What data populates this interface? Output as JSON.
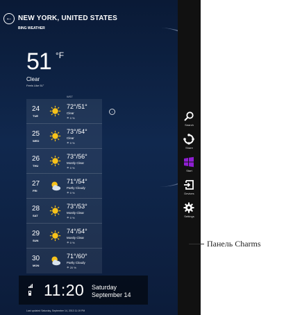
{
  "header": {
    "city": "NEW YORK, UNITED STATES",
    "app_name": "BING WEATHER"
  },
  "current": {
    "temperature": "51",
    "unit": "°F",
    "condition": "Clear",
    "feels_like": "Feels Like 51°",
    "wind_header": "WST"
  },
  "forecast": [
    {
      "date": "24",
      "day": "TUE",
      "hilo": "72°/51°",
      "condition": "Clear",
      "precip": "☂ 0 %",
      "icon": "sun-icon"
    },
    {
      "date": "25",
      "day": "WED",
      "hilo": "73°/54°",
      "condition": "Clear",
      "precip": "☂ 0 %",
      "icon": "sun-icon"
    },
    {
      "date": "26",
      "day": "THU",
      "hilo": "73°/56°",
      "condition": "Mostly Clear",
      "precip": "☂ 0 %",
      "icon": "sun-icon"
    },
    {
      "date": "27",
      "day": "FRI",
      "hilo": "71°/54°",
      "condition": "Partly Cloudy",
      "precip": "☂ 0 %",
      "icon": "partly-cloudy-icon"
    },
    {
      "date": "28",
      "day": "SAT",
      "hilo": "73°/53°",
      "condition": "Mostly Clear",
      "precip": "☂ 0 %",
      "icon": "sun-icon"
    },
    {
      "date": "29",
      "day": "SUN",
      "hilo": "74°/54°",
      "condition": "Mostly Clear",
      "precip": "☂ 0 %",
      "icon": "sun-icon"
    },
    {
      "date": "30",
      "day": "MON",
      "hilo": "71°/60°",
      "condition": "Partly Cloudy",
      "precip": "☂ 20 %",
      "icon": "partly-cloudy-icon"
    }
  ],
  "lock": {
    "time": "11:20",
    "weekday": "Saturday",
    "date": "September 14"
  },
  "footer": {
    "updated": "Last updated Saturday, September 14, 2013 11:19 PM"
  },
  "charms": [
    {
      "label": "Search",
      "icon": "search-icon"
    },
    {
      "label": "Share",
      "icon": "share-icon"
    },
    {
      "label": "Start",
      "icon": "windows-logo-icon"
    },
    {
      "label": "Devices",
      "icon": "devices-icon"
    },
    {
      "label": "Settings",
      "icon": "gear-icon"
    }
  ],
  "callout": {
    "label": "Панель Charms"
  },
  "colors": {
    "background": "#10284e",
    "charms_bar": "#111111",
    "start_tile": "#8f1fd3",
    "sun": "#f7c21a"
  }
}
